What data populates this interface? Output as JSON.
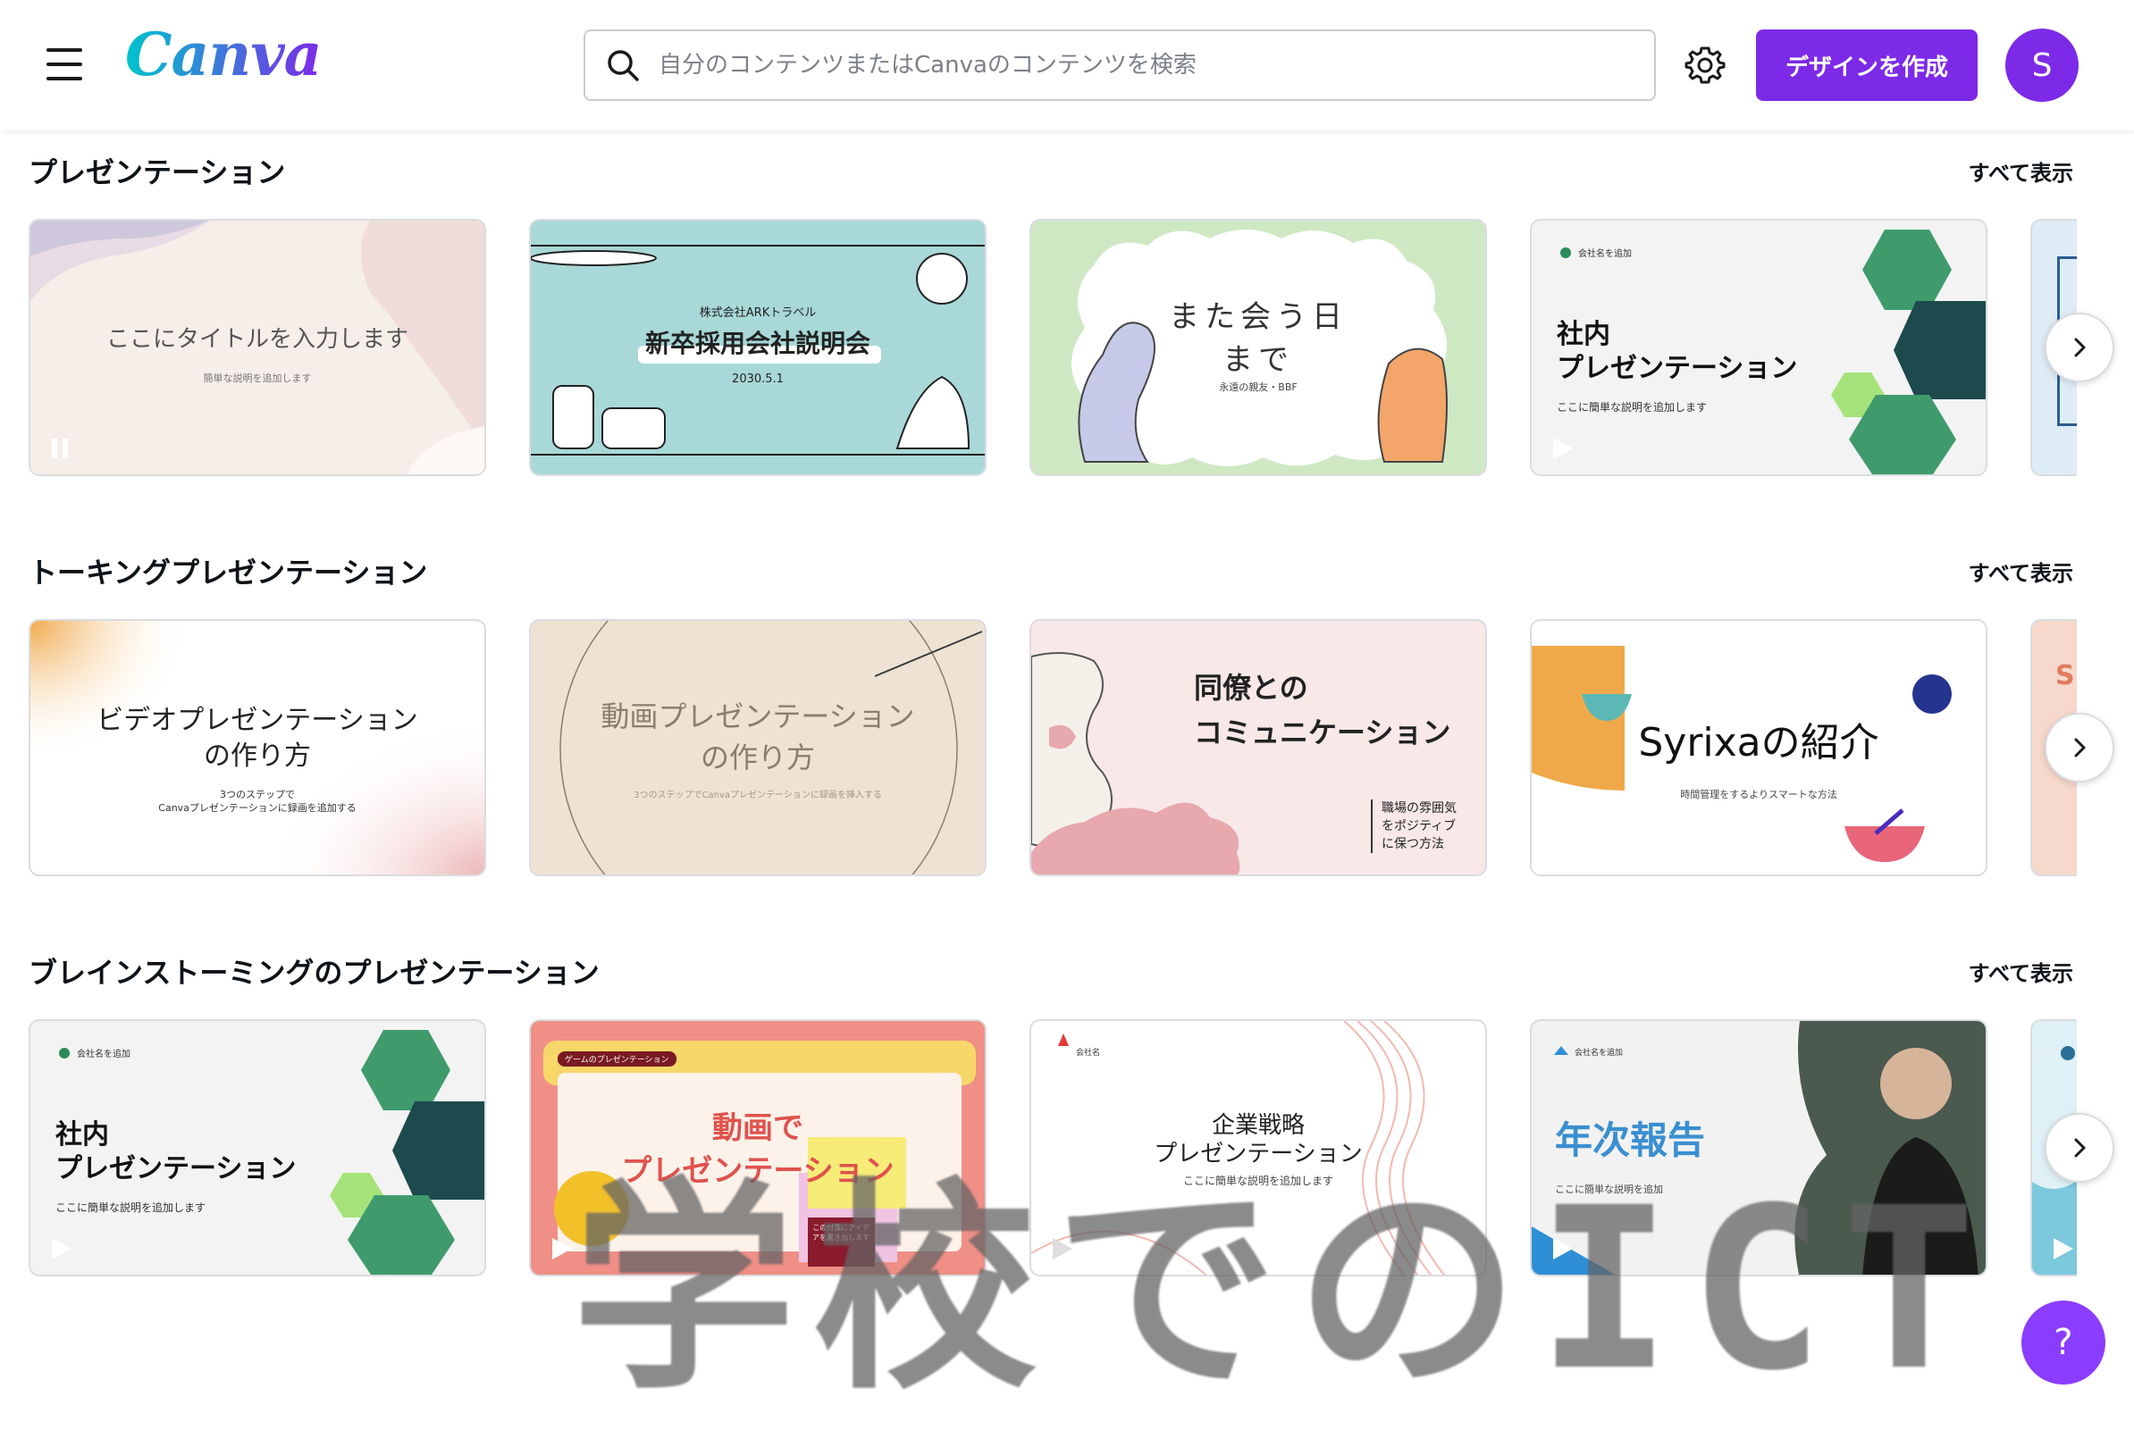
{
  "header": {
    "logo": "Canva",
    "search_placeholder": "自分のコンテンツまたはCanvaのコンテンツを検索",
    "create_button": "デザインを作成",
    "avatar_initial": "S",
    "icons": [
      "menu-icon",
      "search-icon",
      "gear-icon"
    ]
  },
  "sections": [
    {
      "title": "プレゼンテーション",
      "see_all": "すべて表示",
      "cards": [
        {
          "title": "ここにタイトルを入力します",
          "subtitle": "簡単な説明を追加します"
        },
        {
          "company": "株式会社ARKトラベル",
          "title": "新卒採用会社説明会",
          "date": "2030.5.1"
        },
        {
          "title_line1": "また会う日",
          "title_line2": "まで",
          "subtitle": "永遠の親友・BBF"
        },
        {
          "company": "会社名を追加",
          "title_line1": "社内",
          "title_line2": "プレゼンテーション",
          "subtitle": "ここに簡単な説明を追加します"
        }
      ]
    },
    {
      "title": "トーキングプレゼンテーション",
      "see_all": "すべて表示",
      "cards": [
        {
          "title_line1": "ビデオプレゼンテーション",
          "title_line2": "の作り方",
          "sub1": "3つのステップで",
          "sub2": "Canvaプレゼンテーションに録画を追加する"
        },
        {
          "title_line1": "動画プレゼンテーション",
          "title_line2": "の作り方",
          "subtitle": "3つのステップでCanvaプレゼンテーションに録画を挿入する"
        },
        {
          "title_line1": "同僚との",
          "title_line2": "コミュニケーション",
          "note1": "職場の雰囲気",
          "note2": "をポジティブ",
          "note3": "に保つ方法"
        },
        {
          "title": "Syrixaの紹介",
          "subtitle": "時間管理をするよりスマートな方法"
        }
      ],
      "partial_card_text": "S"
    },
    {
      "title": "ブレインストーミングのプレゼンテーション",
      "see_all": "すべて表示",
      "cards": [
        {
          "company": "会社名を追加",
          "title_line1": "社内",
          "title_line2": "プレゼンテーション",
          "subtitle": "ここに簡単な説明を追加します"
        },
        {
          "tag": "ゲームのプレゼンテーション",
          "title_line1": "動画で",
          "title_line2": "プレゼンテーション",
          "sticky": "この付箋にアイデアを書き出します"
        },
        {
          "company": "会社名",
          "title_line1": "企業戦略",
          "title_line2": "プレゼンテーション",
          "subtitle": "ここに簡単な説明を追加します"
        },
        {
          "company": "会社名を追加",
          "title": "年次報告",
          "subtitle": "ここに簡単な説明を追加"
        }
      ]
    }
  ],
  "watermark": "学校でのICT",
  "help_button": "?",
  "colors": {
    "brand_purple": "#7d2ae8",
    "help_purple": "#8b3dff"
  }
}
